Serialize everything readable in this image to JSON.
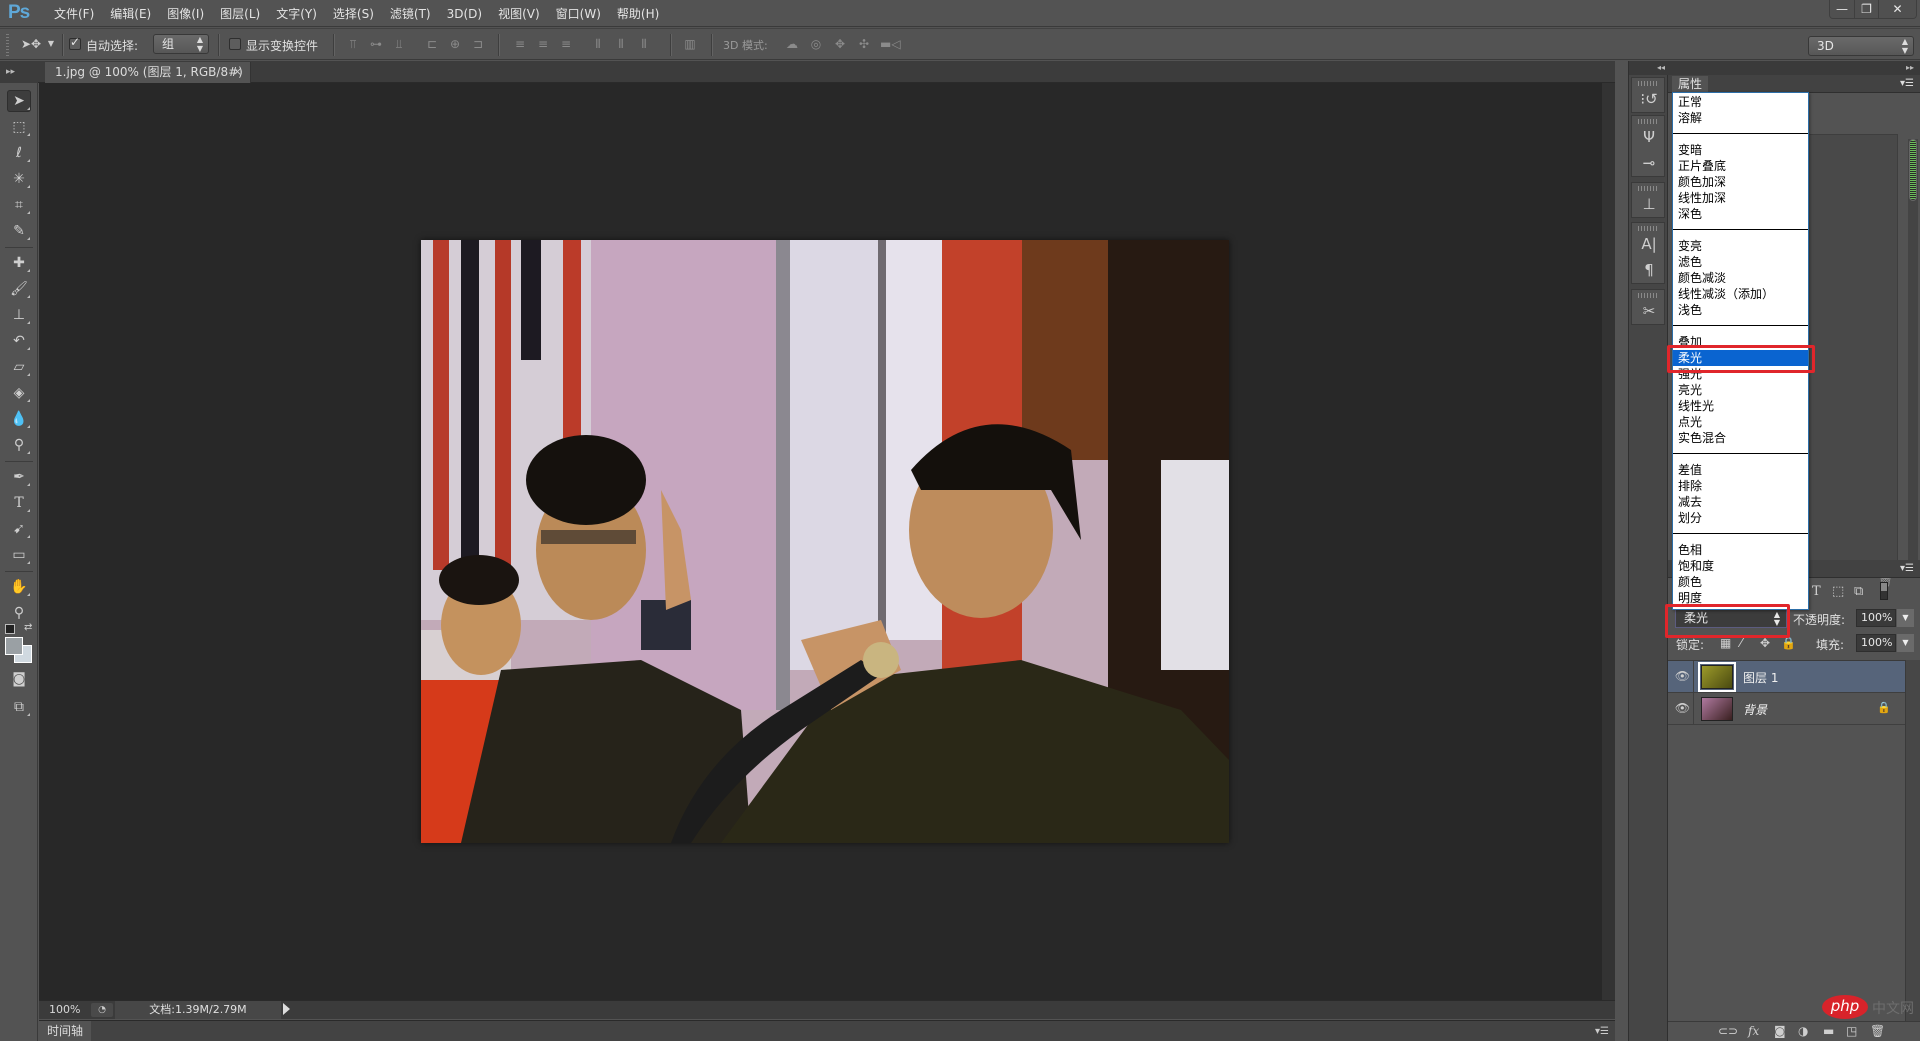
{
  "app": {
    "logo": "Ps"
  },
  "menu": [
    "文件(F)",
    "编辑(E)",
    "图像(I)",
    "图层(L)",
    "文字(Y)",
    "选择(S)",
    "滤镜(T)",
    "3D(D)",
    "视图(V)",
    "窗口(W)",
    "帮助(H)"
  ],
  "window_controls": {
    "minimize": "—",
    "restore": "❐",
    "close": "✕"
  },
  "options_bar": {
    "auto_select_label": "自动选择:",
    "auto_select_checked": true,
    "auto_select_value": "组",
    "show_transform_label": "显示变换控件",
    "show_transform_checked": false,
    "mode_3d_label": "3D 模式:",
    "workspace_value": "3D"
  },
  "document": {
    "tab_title": "1.jpg @ 100% (图层 1, RGB/8#) *",
    "tab_close": "×"
  },
  "status_bar": {
    "zoom": "100%",
    "doc_info": "文档:1.39M/2.79M"
  },
  "timeline": {
    "tab": "时间轴"
  },
  "properties_panel": {
    "tab": "属性"
  },
  "blend_menu": {
    "groups": [
      [
        "正常",
        "溶解"
      ],
      [
        "变暗",
        "正片叠底",
        "颜色加深",
        "线性加深",
        "深色"
      ],
      [
        "变亮",
        "滤色",
        "颜色减淡",
        "线性减淡（添加）",
        "浅色"
      ],
      [
        "叠加",
        "柔光",
        "强光",
        "亮光",
        "线性光",
        "点光",
        "实色混合"
      ],
      [
        "差值",
        "排除",
        "减去",
        "划分"
      ],
      [
        "色相",
        "饱和度",
        "颜色",
        "明度"
      ]
    ],
    "highlighted": "柔光"
  },
  "layers_panel": {
    "blend_mode": "柔光",
    "opacity_label": "不透明度:",
    "opacity": "100%",
    "lock_label": "锁定:",
    "fill_label": "填充:",
    "fill": "100%",
    "layers": [
      {
        "name": "图层 1",
        "selected": true,
        "visible": true,
        "locked": false
      },
      {
        "name": "背景",
        "selected": false,
        "visible": true,
        "locked": true
      }
    ]
  },
  "watermark": {
    "brand": "php",
    "text": "中文网"
  },
  "colors": {
    "highlight": "#0a64d0",
    "annotation_red": "#e0262b",
    "selected_layer": "#56647a"
  }
}
